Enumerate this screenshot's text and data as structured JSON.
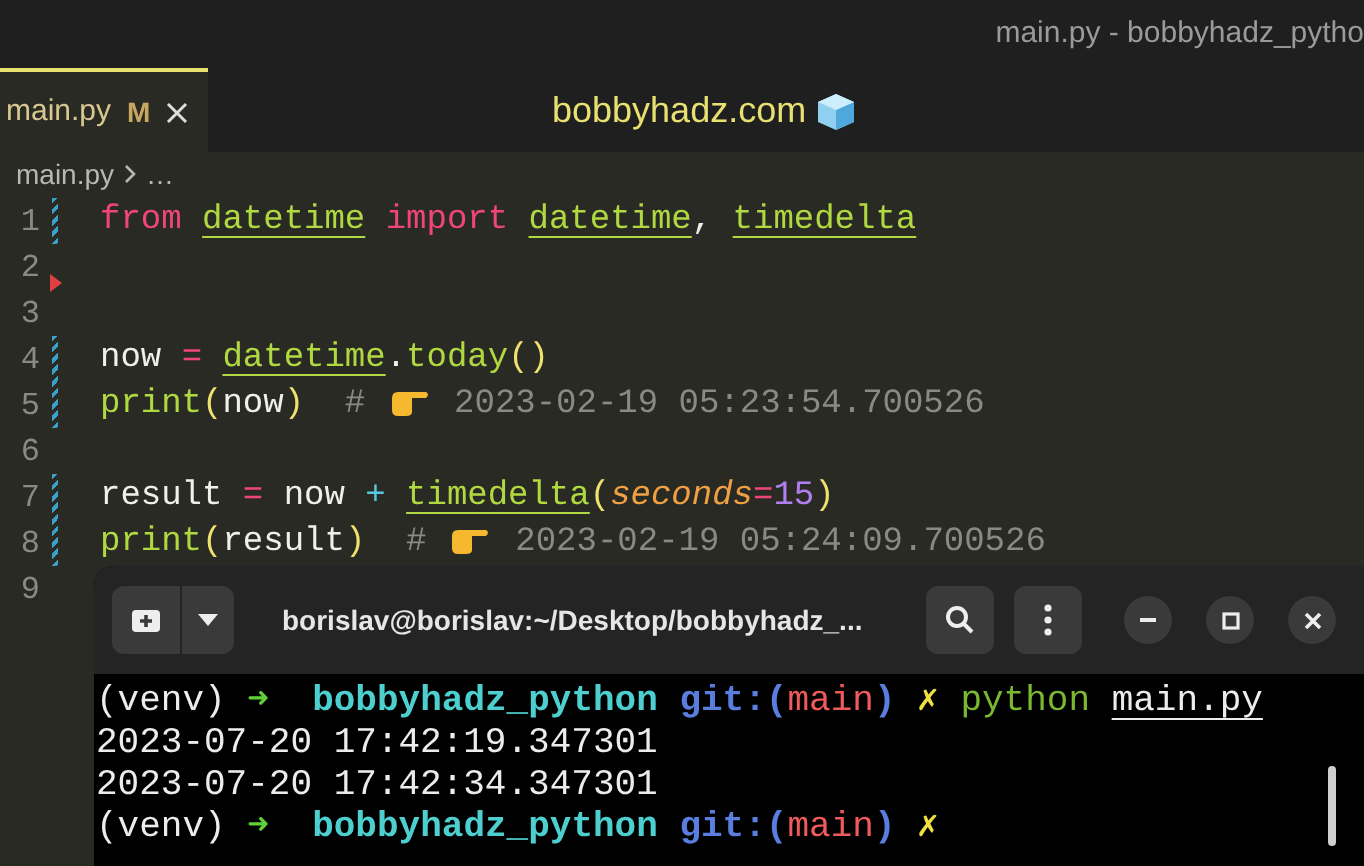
{
  "window": {
    "title": "main.py - bobbyhadz_pytho"
  },
  "tabs": [
    {
      "label": "main.py",
      "badge": "M",
      "selected": true
    }
  ],
  "banner": {
    "text": "bobbyhadz.com"
  },
  "breadcrumb": [
    "main.py",
    "…"
  ],
  "editor": {
    "lines": [
      {
        "number": "1",
        "modified": true,
        "tokens": [
          {
            "kind": "keyword",
            "text": "from "
          },
          {
            "kind": "name",
            "text": "datetime"
          },
          {
            "kind": "keyword",
            "text": " import "
          },
          {
            "kind": "name",
            "text": "datetime"
          },
          {
            "kind": "plain",
            "text": ", "
          },
          {
            "kind": "name",
            "text": "timedelta"
          }
        ]
      },
      {
        "number": "2",
        "deleted": true
      },
      {
        "number": "3"
      },
      {
        "number": "4",
        "modified": true,
        "tokens": [
          {
            "kind": "plain",
            "text": "now "
          },
          {
            "kind": "op",
            "text": "= "
          },
          {
            "kind": "name",
            "text": "datetime"
          },
          {
            "kind": "plain",
            "text": "."
          },
          {
            "kind": "func",
            "text": "today"
          },
          {
            "kind": "paren",
            "text": "()"
          }
        ]
      },
      {
        "number": "5",
        "modified": true,
        "tokens": [
          {
            "kind": "func",
            "text": "print"
          },
          {
            "kind": "paren",
            "text": "("
          },
          {
            "kind": "plain",
            "text": "now"
          },
          {
            "kind": "paren",
            "text": ")"
          },
          {
            "kind": "comment",
            "text": "  # "
          },
          {
            "kind": "pointer"
          },
          {
            "kind": "comment",
            "text": " 2023-02-19 05:23:54.700526"
          }
        ]
      },
      {
        "number": "6"
      },
      {
        "number": "7",
        "modified": true,
        "tokens": [
          {
            "kind": "plain",
            "text": "result "
          },
          {
            "kind": "op",
            "text": "="
          },
          {
            "kind": "plain",
            "text": " now "
          },
          {
            "kind": "op2",
            "text": "+ "
          },
          {
            "kind": "name",
            "text": "timedelta"
          },
          {
            "kind": "paren",
            "text": "("
          },
          {
            "kind": "param",
            "text": "seconds"
          },
          {
            "kind": "op",
            "text": "="
          },
          {
            "kind": "number",
            "text": "15"
          },
          {
            "kind": "paren",
            "text": ")"
          }
        ]
      },
      {
        "number": "8",
        "modified": true,
        "tokens": [
          {
            "kind": "func",
            "text": "print"
          },
          {
            "kind": "paren",
            "text": "("
          },
          {
            "kind": "plain",
            "text": "result"
          },
          {
            "kind": "paren",
            "text": ")"
          },
          {
            "kind": "comment",
            "text": "  # "
          },
          {
            "kind": "pointer"
          },
          {
            "kind": "comment",
            "text": " 2023-02-19 05:24:09.700526"
          }
        ]
      },
      {
        "number": "9"
      }
    ]
  },
  "terminal": {
    "title": "borislav@borislav:~/Desktop/bobbyhadz_...",
    "lines": [
      [
        {
          "kind": "plain",
          "text": "(venv) "
        },
        {
          "kind": "arrow",
          "text": "➜  "
        },
        {
          "kind": "dir",
          "text": "bobbyhadz_python"
        },
        {
          "kind": "git",
          "text": " git:("
        },
        {
          "kind": "branch",
          "text": "main"
        },
        {
          "kind": "git",
          "text": ") "
        },
        {
          "kind": "dirty",
          "text": "✗"
        },
        {
          "kind": "cmd",
          "text": " python "
        },
        {
          "kind": "arg",
          "text": "main.py"
        }
      ],
      [
        {
          "kind": "plain",
          "text": "2023-07-20 17:42:19.347301"
        }
      ],
      [
        {
          "kind": "plain",
          "text": "2023-07-20 17:42:34.347301"
        }
      ],
      [
        {
          "kind": "plain",
          "text": "(venv) "
        },
        {
          "kind": "arrow",
          "text": "➜  "
        },
        {
          "kind": "dir",
          "text": "bobbyhadz_python"
        },
        {
          "kind": "git",
          "text": " git:("
        },
        {
          "kind": "branch",
          "text": "main"
        },
        {
          "kind": "git",
          "text": ") "
        },
        {
          "kind": "dirty",
          "text": "✗"
        }
      ]
    ]
  }
}
